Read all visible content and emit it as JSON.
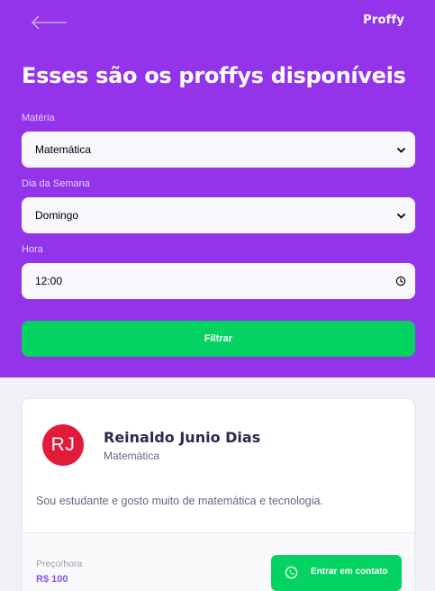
{
  "header": {
    "logo": "Proffy",
    "title": "Esses são os proffys disponíveis"
  },
  "filters": {
    "subject": {
      "label": "Matéria",
      "value": "Matemática"
    },
    "weekday": {
      "label": "Dia da Semana",
      "value": "Domingo"
    },
    "time": {
      "label": "Hora",
      "value": "12:00"
    },
    "submit_label": "Filtrar"
  },
  "teacher": {
    "initials": "RJ",
    "name": "Reinaldo Junio Dias",
    "subject": "Matemática",
    "bio": "Sou estudante e gosto muito de matemática e tecnologia.",
    "price_label": "Preço/hora",
    "price": "R$ 100",
    "contact_label": "Entrar em contato"
  },
  "colors": {
    "header_bg": "#9333EA",
    "accent_green": "#04D361",
    "avatar_red": "#E31B3B",
    "price_purple": "#8257E5"
  }
}
